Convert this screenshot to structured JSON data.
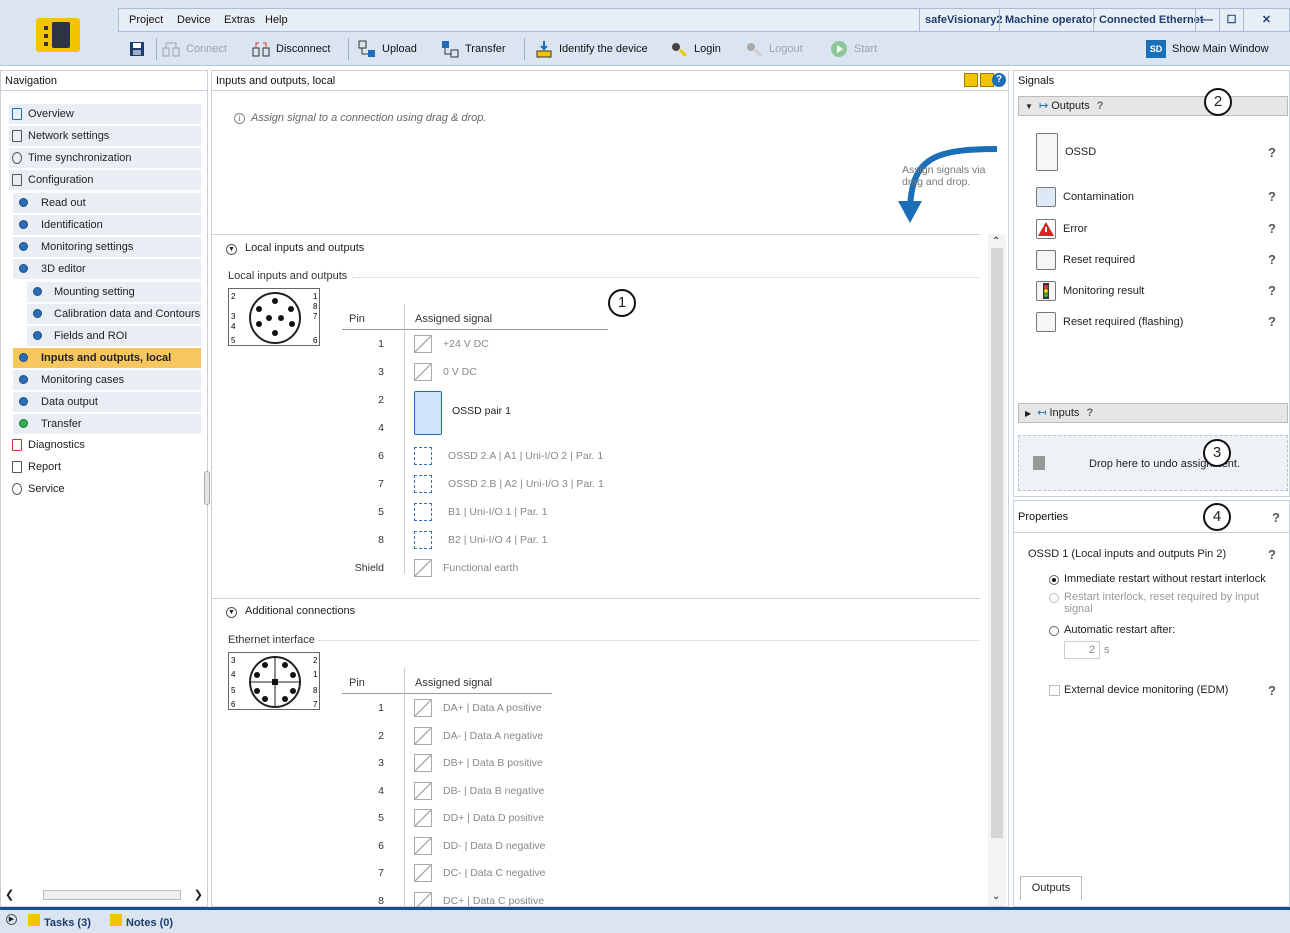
{
  "app": {
    "menu": [
      "Project",
      "Device",
      "Extras",
      "Help"
    ],
    "status": {
      "device": "safeVisionary2",
      "user_level": "Machine operator",
      "connection": "Connected Ethernet"
    },
    "window_buttons": [
      "—",
      "☐",
      "✕"
    ]
  },
  "toolbar": {
    "connect": "Connect",
    "disconnect": "Disconnect",
    "upload": "Upload",
    "transfer": "Transfer",
    "identify": "Identify the device",
    "login": "Login",
    "logout": "Logout",
    "start": "Start",
    "show_main": "Show Main Window",
    "show_main_icon": "SD"
  },
  "navigation": {
    "title": "Navigation",
    "items": [
      "Overview",
      "Network settings",
      "Time synchronization",
      "Configuration",
      "Read out",
      "Identification",
      "Monitoring settings",
      "3D editor",
      "Mounting setting",
      "Calibration data and Contours",
      "Fields and ROI",
      "Inputs and outputs, local",
      "Monitoring cases",
      "Data output",
      "Transfer",
      "Diagnostics",
      "Report",
      "Service"
    ]
  },
  "center": {
    "title": "Inputs and outputs, local",
    "hint": "Assign signal to a connection using drag & drop.",
    "drag_hint": "Assign signals via drag and drop.",
    "local_section": "Local inputs and outputs",
    "local_group": "Local inputs and outputs",
    "col_pin": "Pin",
    "col_signal": "Assigned signal",
    "local_pins": [
      {
        "pin": "1",
        "signal": "+24 V DC",
        "kind": "fixed"
      },
      {
        "pin": "3",
        "signal": "0 V DC",
        "kind": "fixed"
      },
      {
        "pin": "2",
        "signal": "OSSD pair 1",
        "kind": "assigned"
      },
      {
        "pin": "4",
        "signal": "",
        "kind": "assigned-cont"
      },
      {
        "pin": "6",
        "signal": "OSSD 2.A | A1 | Uni-I/O 2 | Par. 1",
        "kind": "empty"
      },
      {
        "pin": "7",
        "signal": "OSSD 2.B | A2 | Uni-I/O 3 | Par. 1",
        "kind": "empty"
      },
      {
        "pin": "5",
        "signal": "B1 | Uni-I/O 1 | Par. 1",
        "kind": "empty"
      },
      {
        "pin": "8",
        "signal": "B2 | Uni-I/O 4 | Par. 1",
        "kind": "empty"
      },
      {
        "pin": "Shield",
        "signal": "Functional earth",
        "kind": "fixed"
      }
    ],
    "additional_section": "Additional connections",
    "ethernet_group": "Ethernet interface",
    "eth_pins": [
      {
        "pin": "1",
        "signal": "DA+ | Data A positive"
      },
      {
        "pin": "2",
        "signal": "DA- | Data A negative"
      },
      {
        "pin": "3",
        "signal": "DB+ | Data B positive"
      },
      {
        "pin": "4",
        "signal": "DB- | Data B negative"
      },
      {
        "pin": "5",
        "signal": "DD+ | Data D positive"
      },
      {
        "pin": "6",
        "signal": "DD- | Data D negative"
      },
      {
        "pin": "7",
        "signal": "DC- | Data C negative"
      },
      {
        "pin": "8",
        "signal": "DC+ | Data C positive"
      }
    ],
    "callout": "1"
  },
  "signals": {
    "title": "Signals",
    "outputs_header": "Outputs",
    "outputs": [
      "OSSD",
      "Contamination",
      "Error",
      "Reset required",
      "Monitoring result",
      "Reset required (flashing)"
    ],
    "inputs_header": "Inputs",
    "drop_text": "Drop here to undo assignment.",
    "callout_2": "2",
    "callout_3": "3"
  },
  "properties": {
    "title": "Properties",
    "callout_4": "4",
    "heading": "OSSD 1 (Local inputs and outputs Pin 2)",
    "opt_immediate": "Immediate restart without restart interlock",
    "opt_interlock": "Restart interlock, reset required by input signal",
    "opt_auto": "Automatic restart after:",
    "auto_value": "2",
    "auto_unit": "s",
    "edm": "External device monitoring (EDM)",
    "tab": "Outputs",
    "selected_option": "immediate"
  },
  "statusbar": {
    "tasks": "Tasks (3)",
    "notes": "Notes (0)"
  },
  "colors": {
    "accent": "#1b6fb8",
    "selected": "#f7c65f",
    "toolbar_bg": "#dbe5f1"
  }
}
